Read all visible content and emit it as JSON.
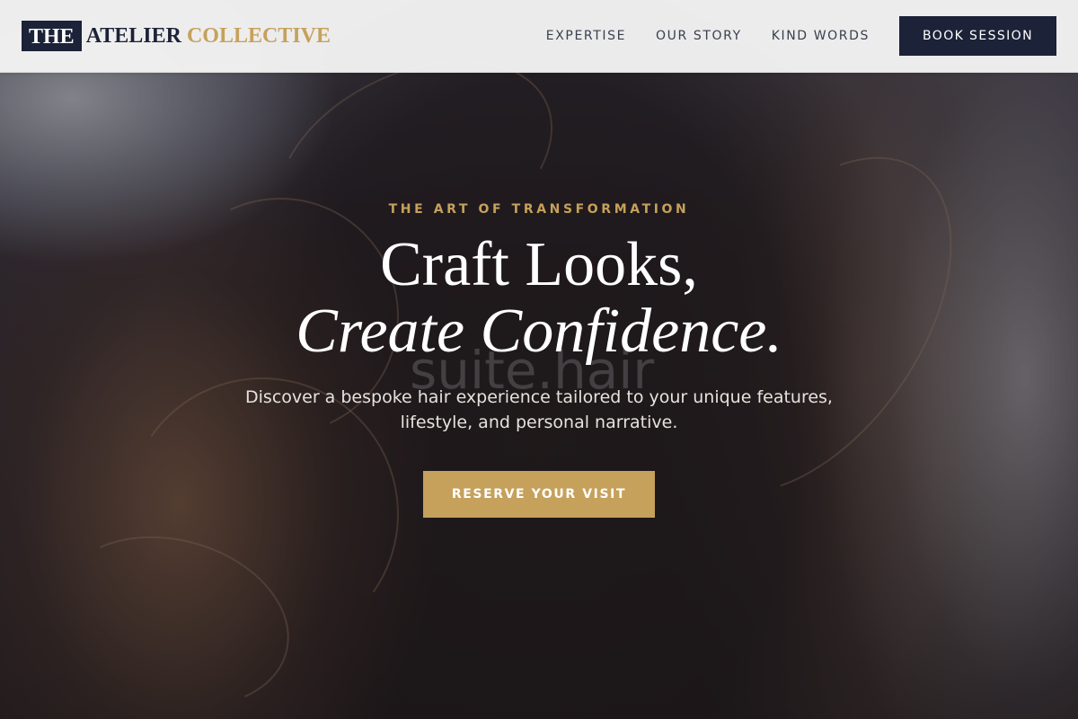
{
  "header": {
    "logo": {
      "part1": "THE",
      "part2": "ATELIER",
      "part3": "COLLECTIVE"
    },
    "nav": [
      {
        "label": "EXPERTISE"
      },
      {
        "label": "OUR STORY"
      },
      {
        "label": "KIND WORDS"
      }
    ],
    "cta_label": "BOOK SESSION"
  },
  "hero": {
    "eyebrow": "THE ART OF TRANSFORMATION",
    "headline_line1": "Craft Looks,",
    "headline_line2": "Create Confidence.",
    "subtext": "Discover a bespoke hair experience tailored to your unique features, lifestyle, and personal narrative.",
    "cta_label": "RESERVE YOUR VISIT",
    "watermark": "suite.hair"
  },
  "colors": {
    "navy": "#1c2237",
    "gold": "#c6a15b",
    "header_bg": "#f4f4f4"
  }
}
